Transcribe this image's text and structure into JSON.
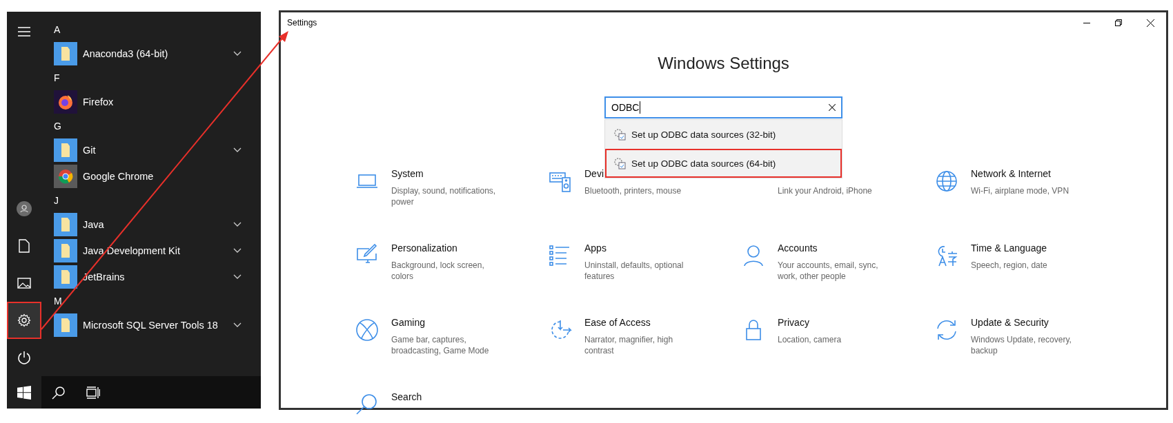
{
  "start_menu": {
    "rail": [
      {
        "kind": "menu",
        "annotated": false
      },
      {
        "kind": "user",
        "annotated": false
      },
      {
        "kind": "document",
        "annotated": false
      },
      {
        "kind": "picture",
        "annotated": false
      },
      {
        "kind": "settings",
        "annotated": true
      },
      {
        "kind": "power",
        "annotated": false
      }
    ],
    "sections": [
      {
        "letter": "A",
        "apps": [
          {
            "name": "Anaconda3 (64-bit)",
            "kind": "folder",
            "expandable": true
          }
        ]
      },
      {
        "letter": "F",
        "apps": [
          {
            "name": "Firefox",
            "kind": "firefox",
            "expandable": false
          }
        ]
      },
      {
        "letter": "G",
        "apps": [
          {
            "name": "Git",
            "kind": "folder",
            "expandable": true
          },
          {
            "name": "Google Chrome",
            "kind": "chrome",
            "expandable": false
          }
        ]
      },
      {
        "letter": "J",
        "apps": [
          {
            "name": "Java",
            "kind": "folder",
            "expandable": true
          },
          {
            "name": "Java Development Kit",
            "kind": "folder",
            "expandable": true
          },
          {
            "name": "JetBrains",
            "kind": "folder",
            "expandable": true
          }
        ]
      },
      {
        "letter": "M",
        "apps": [
          {
            "name": "Microsoft SQL Server Tools 18",
            "kind": "folder",
            "expandable": true
          }
        ]
      }
    ]
  },
  "window": {
    "title": "Settings"
  },
  "heading": "Windows Settings",
  "search": {
    "value": "ODBC",
    "results": [
      {
        "label": "Set up ODBC data sources (32-bit)",
        "annotated": false
      },
      {
        "label": "Set up ODBC data sources (64-bit)",
        "annotated": true
      }
    ]
  },
  "categories": [
    {
      "kind": "system",
      "title": "System",
      "description": "Display, sound, notifications, power"
    },
    {
      "kind": "devices",
      "title": "Devi",
      "description": "Bluetooth, printers, mouse"
    },
    {
      "kind": "phone",
      "description": "Link your Android, iPhone"
    },
    {
      "kind": "network",
      "title": "Network & Internet",
      "description": "Wi-Fi, airplane mode, VPN"
    },
    {
      "kind": "personalization",
      "title": "Personalization",
      "description": "Background, lock screen, colors"
    },
    {
      "kind": "apps",
      "title": "Apps",
      "description": "Uninstall, defaults, optional features"
    },
    {
      "kind": "accounts",
      "title": "Accounts",
      "description": "Your accounts, email, sync, work, other people"
    },
    {
      "kind": "time",
      "title": "Time & Language",
      "description": "Speech, region, date"
    },
    {
      "kind": "gaming",
      "title": "Gaming",
      "description": "Game bar, captures, broadcasting, Game Mode"
    },
    {
      "kind": "ease",
      "title": "Ease of Access",
      "description": "Narrator, magnifier, high contrast"
    },
    {
      "kind": "privacy",
      "title": "Privacy",
      "description": "Location, camera"
    },
    {
      "kind": "update",
      "title": "Update & Security",
      "description": "Windows Update, recovery, backup"
    },
    {
      "kind": "search",
      "title": "Search"
    }
  ]
}
